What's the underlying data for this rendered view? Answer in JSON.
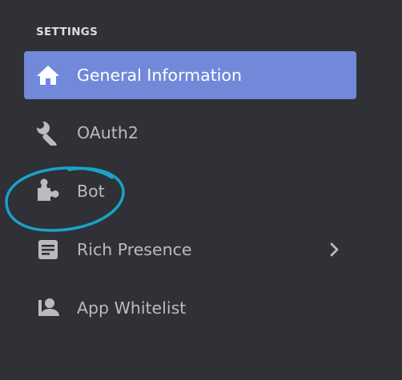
{
  "settings": {
    "header": "SETTINGS",
    "items": [
      {
        "label": "General Information",
        "icon": "home-icon",
        "active": true
      },
      {
        "label": "OAuth2",
        "icon": "wrench-icon",
        "active": false
      },
      {
        "label": "Bot",
        "icon": "puzzle-piece-icon",
        "active": false
      },
      {
        "label": "Rich Presence",
        "icon": "document-icon",
        "active": false,
        "has_submenu": true
      },
      {
        "label": "App Whitelist",
        "icon": "person-icon",
        "active": false
      }
    ]
  },
  "colors": {
    "background": "#2f3136",
    "active_item": "#7289da",
    "text": "#b9bbbe",
    "annotation_circle": "#1aa3c7"
  }
}
